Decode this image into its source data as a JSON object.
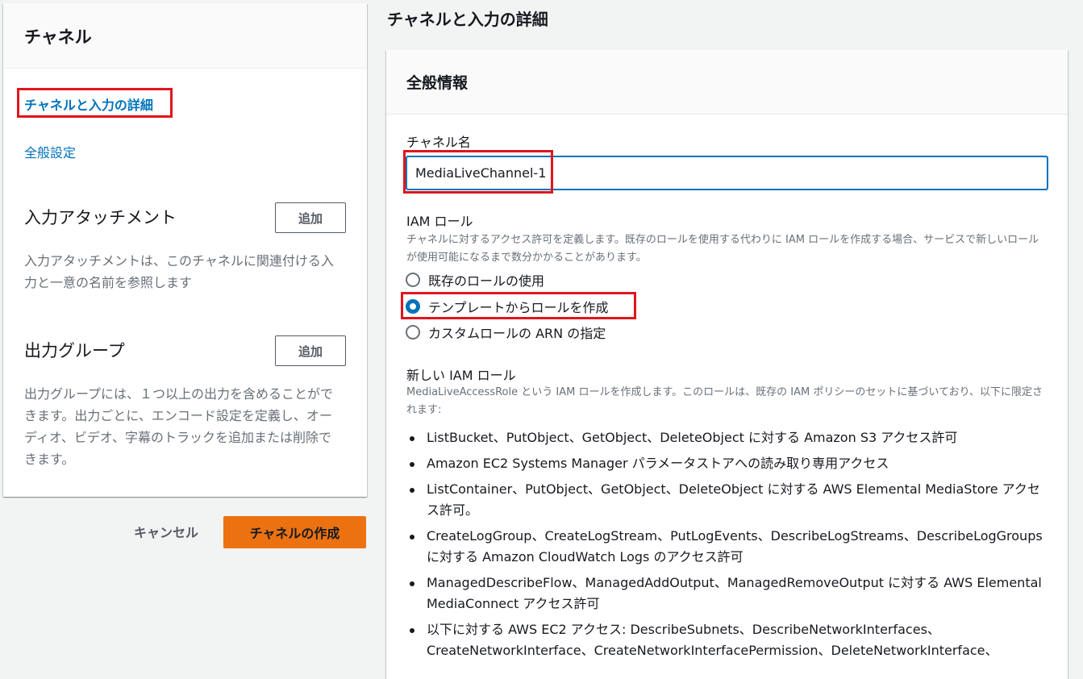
{
  "sidebar": {
    "title": "チャネル",
    "active_link": "チャネルと入力の詳細",
    "general_link": "全般設定",
    "input_attachments": {
      "title": "入力アタッチメント",
      "add_label": "追加",
      "description": "入力アタッチメントは、このチャネルに関連付ける入力と一意の名前を参照します"
    },
    "output_groups": {
      "title": "出力グループ",
      "add_label": "追加",
      "description": "出力グループには、１つ以上の出力を含めることができます。出力ごとに、エンコード設定を定義し、オーディオ、ビデオ、字幕のトラックを追加または削除できます。"
    },
    "cancel_label": "キャンセル",
    "create_label": "チャネルの作成"
  },
  "main": {
    "heading": "チャネルと入力の詳細",
    "panel_title": "全般情報",
    "channel_name_label": "チャネル名",
    "channel_name_value": "MediaLiveChannel-1",
    "iam_role_label": "IAM ロール",
    "iam_role_desc": "チャネルに対するアクセス許可を定義します。既存のロールを使用する代わりに IAM ロールを作成する場合、サービスで新しいロールが使用可能になるまで数分かかることがあります。",
    "radio_options": [
      {
        "label": "既存のロールの使用",
        "checked": false
      },
      {
        "label": "テンプレートからロールを作成",
        "checked": true
      },
      {
        "label": "カスタムロールの ARN の指定",
        "checked": false
      }
    ],
    "new_role_label": "新しい IAM ロール",
    "new_role_desc": "MediaLiveAccessRole という IAM ロールを作成します。このロールは、既存の IAM ポリシーのセットに基づいており、以下に限定されます:",
    "permissions": [
      "ListBucket、PutObject、GetObject、DeleteObject に対する Amazon S3 アクセス許可",
      "Amazon EC2 Systems Manager パラメータストアへの読み取り専用アクセス",
      "ListContainer、PutObject、GetObject、DeleteObject に対する AWS Elemental MediaStore アクセス許可。",
      "CreateLogGroup、CreateLogStream、PutLogEvents、DescribeLogStreams、DescribeLogGroups に対する Amazon CloudWatch Logs のアクセス許可",
      "ManagedDescribeFlow、ManagedAddOutput、ManagedRemoveOutput に対する AWS Elemental MediaConnect アクセス許可",
      "以下に対する AWS EC2 アクセス: DescribeSubnets、DescribeNetworkInterfaces、CreateNetworkInterface、CreateNetworkInterfacePermission、DeleteNetworkInterface、"
    ]
  },
  "colors": {
    "accent": "#0073bb",
    "primary_button": "#ec7211",
    "highlight": "#e0151d"
  }
}
